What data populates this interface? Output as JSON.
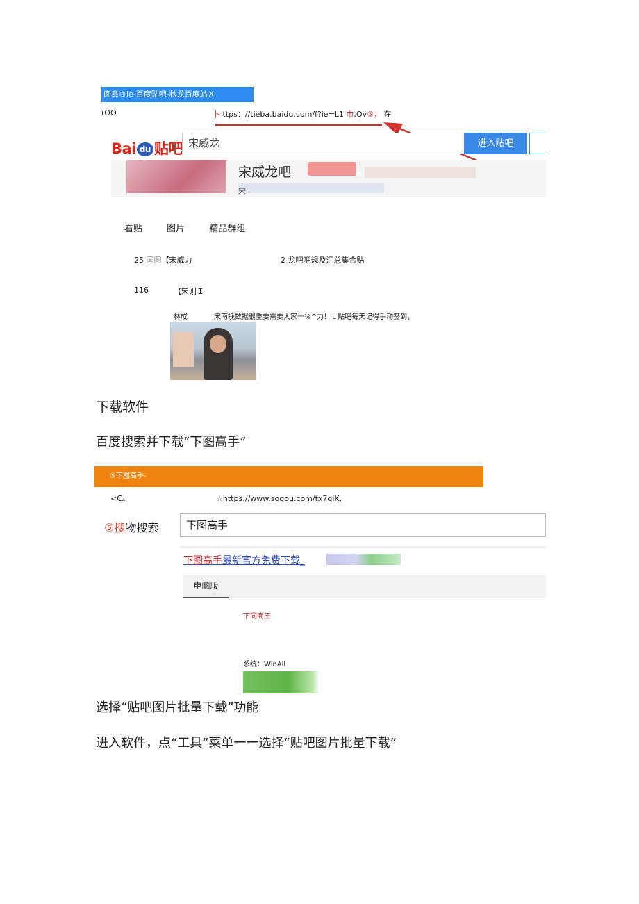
{
  "shot1": {
    "tab_title": "囱拿®le-百度贴吧-秋龙百度站Ｘ",
    "back": "(OO",
    "url_prefix": "卜",
    "url_main": "ttps：//tieba.baidu.com/f?ie=L1",
    "url_red": "巾",
    "url_tail": ",Qv",
    "url_circ": "⑤，",
    "url_end": "在",
    "logo_bai": "Bai",
    "logo_du": "du",
    "logo_tieba": "贴吧",
    "search_value": "宋威龙",
    "enter_button": "进入贴吧",
    "bar_name": "宋威龙吧",
    "bar_sub": "宋",
    "tabs": [
      "看贴",
      "图片",
      "精品群组"
    ],
    "posts": [
      {
        "count": "25",
        "tag": "国图",
        "title": "【宋威力",
        "title2": "2 龙吧吧规及汇总集合贴"
      },
      {
        "count": "116",
        "title": "【宋则Ｉ"
      }
    ],
    "author": "林成",
    "message": "宋南挽数据很重要需要大家一⅛^力！Ｌ贴吧每天记得手动签到，"
  },
  "heading1": "下载软件",
  "heading2": "百度搜索并下载“下图高手”",
  "shot2": {
    "tab_title": "⑤下图高手-",
    "back": "<C",
    "back_icon": "▵",
    "url": "☆https://www.sogou.com/tx7qiK.",
    "logo_circ": "⑤",
    "logo_red": "搜",
    "logo_rest": "物搜索",
    "search_value": "下图高手",
    "result_red": "下图高手",
    "result_rest": "最新官方免费下载_",
    "tab_pc": "电脑版",
    "result_name": "下同商王",
    "system": "系统：WinAll"
  },
  "heading3": "选择“贴吧图片批量下载”功能",
  "heading4": "进入软件，点“工具”菜单一一选择“贴吧图片批量下载”"
}
